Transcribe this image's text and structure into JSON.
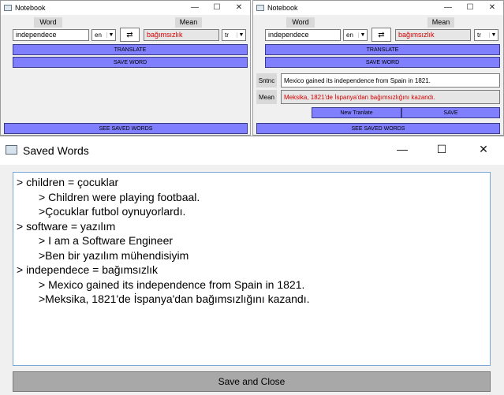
{
  "left_window": {
    "title": "Notebook",
    "controls": {
      "minimize": "—",
      "maximize": "☐",
      "close": "✕"
    },
    "word_label": "Word",
    "mean_label": "Mean",
    "word_value": "independece",
    "src_lang": "en",
    "swap_icon": "swap-arrows-icon",
    "mean_value": "bağımsızlık",
    "dst_lang": "tr",
    "translate_label": "TRANSLATE",
    "save_word_label": "SAVE WORD",
    "see_saved_label": "SEE SAVED WORDS"
  },
  "right_window": {
    "title": "Notebook",
    "controls": {
      "minimize": "—",
      "maximize": "☐",
      "close": "✕"
    },
    "word_label": "Word",
    "mean_label": "Mean",
    "word_value": "independece",
    "src_lang": "en",
    "mean_value": "bağımsızlık",
    "dst_lang": "tr",
    "translate_label": "TRANSLATE",
    "save_word_label": "SAVE WORD",
    "sentence_label": "Sntnc",
    "sentence_value": "Mexico gained its independence from Spain in 1821.",
    "sentence_mean_label": "Mean",
    "sentence_mean_value": "Meksika, 1821'de İspanya'dan bağımsızlığını kazandı.",
    "new_translate_label": "New Tranlate",
    "save_label": "SAVE",
    "see_saved_label": "SEE SAVED WORDS"
  },
  "saved_window": {
    "title": "Saved Words",
    "controls": {
      "minimize": "—",
      "maximize": "☐",
      "close": "✕"
    },
    "lines": [
      {
        "text": "> children = çocuklar",
        "indent": false
      },
      {
        "text": "> Children were playing footbaal.",
        "indent": true
      },
      {
        "text": ">Çocuklar futbol oynuyorlardı.",
        "indent": true
      },
      {
        "text": "> software = yazılım",
        "indent": false
      },
      {
        "text": "> I am a Software Engineer",
        "indent": true
      },
      {
        "text": ">Ben bir yazılım mühendisiyim",
        "indent": true
      },
      {
        "text": "> independece = bağımsızlık",
        "indent": false
      },
      {
        "text": "> Mexico gained its independence from Spain in 1821.",
        "indent": true
      },
      {
        "text": ">Meksika, 1821'de İspanya'dan bağımsızlığını kazandı.",
        "indent": true
      }
    ],
    "save_close_label": "Save and Close"
  },
  "colors": {
    "button_blue": "#7f7fff",
    "red_text": "#d40000",
    "window_bg": "#f0f0f0"
  }
}
